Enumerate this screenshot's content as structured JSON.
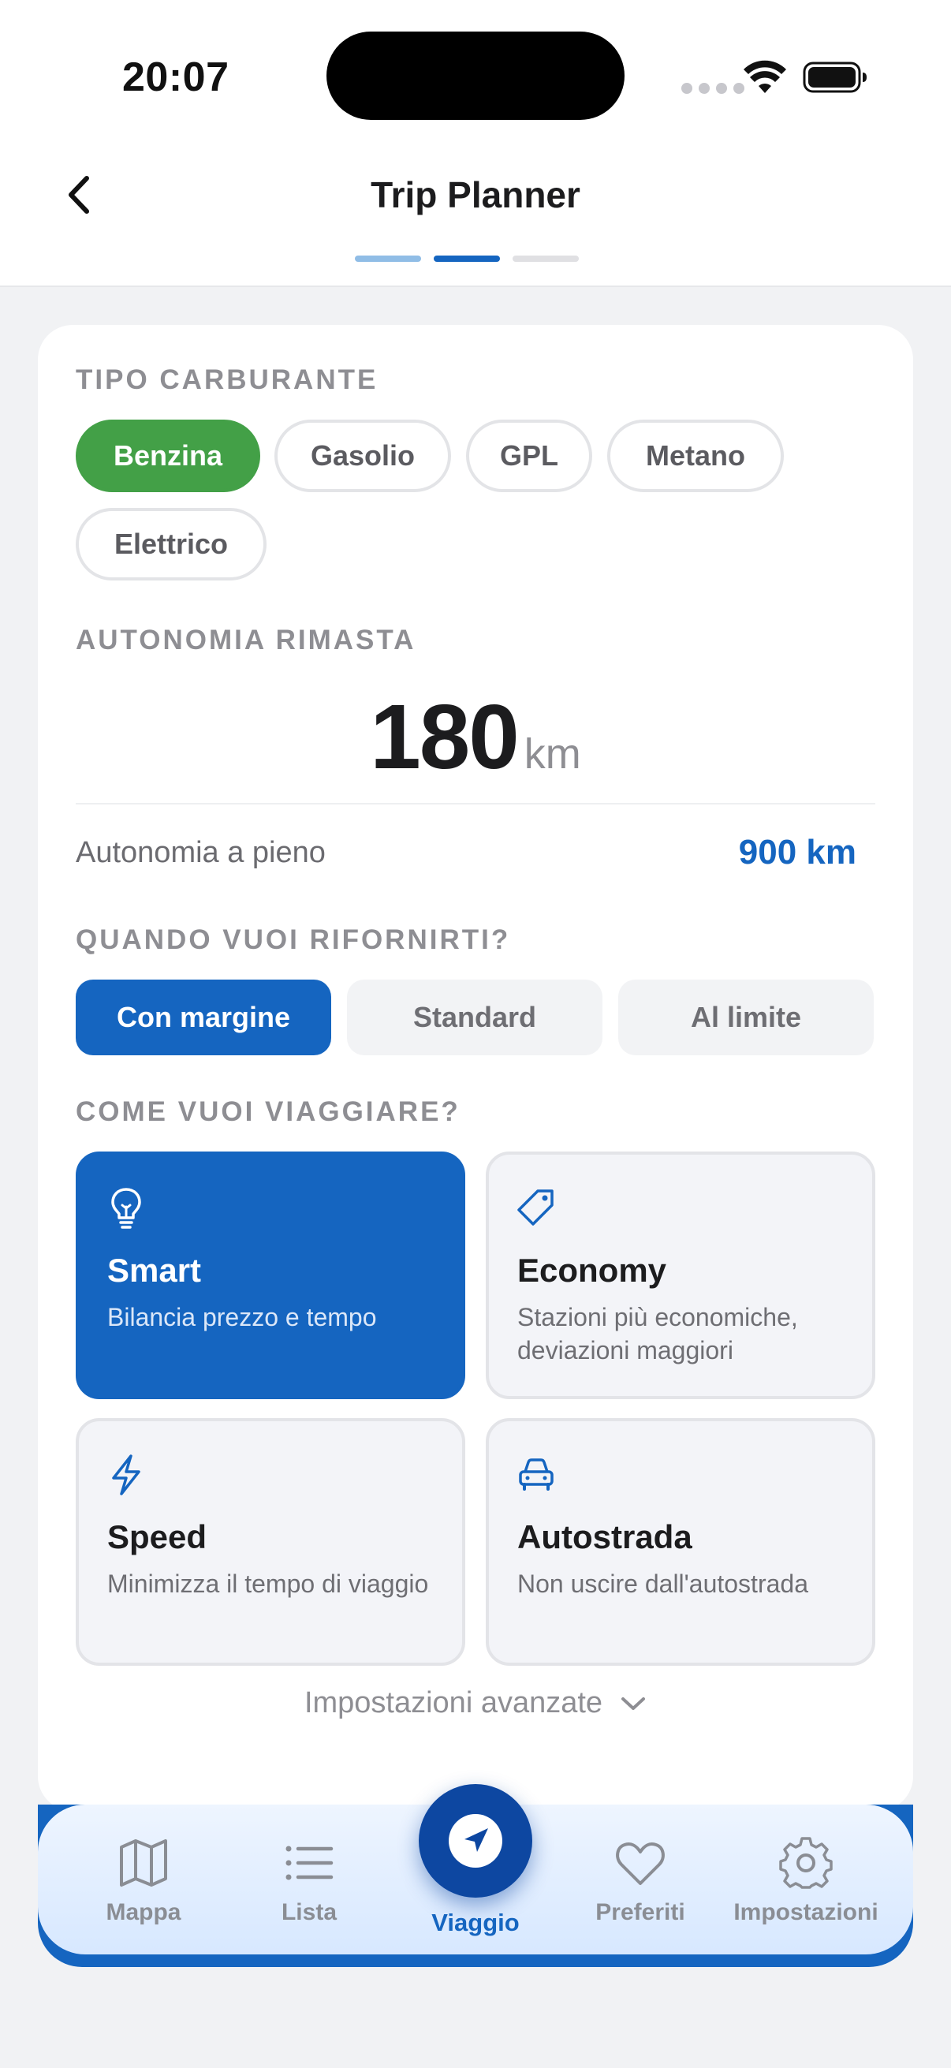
{
  "status": {
    "time": "20:07"
  },
  "header": {
    "title": "Trip Planner"
  },
  "fuel": {
    "label": "TIPO CARBURANTE",
    "options": [
      "Benzina",
      "Gasolio",
      "GPL",
      "Metano",
      "Elettrico"
    ],
    "selected": "Benzina"
  },
  "range": {
    "label": "AUTONOMIA RIMASTA",
    "value": "180",
    "unit": "km",
    "full_label": "Autonomia a pieno",
    "full_value": "900 km"
  },
  "refuel": {
    "label": "QUANDO VUOI RIFORNIRTI?",
    "options": [
      "Con margine",
      "Standard",
      "Al limite"
    ],
    "selected": "Con margine"
  },
  "travel": {
    "label": "COME VUOI VIAGGIARE?",
    "modes": [
      {
        "title": "Smart",
        "desc": "Bilancia prezzo e tempo",
        "icon": "lightbulb-icon"
      },
      {
        "title": "Economy",
        "desc": "Stazioni più economiche, deviazioni maggiori",
        "icon": "tag-icon"
      },
      {
        "title": "Speed",
        "desc": "Minimizza il tempo di viaggio",
        "icon": "lightning-icon"
      },
      {
        "title": "Autostrada",
        "desc": "Non uscire dall'autostrada",
        "icon": "car-icon"
      }
    ],
    "selected": "Smart"
  },
  "advanced": {
    "label": "Impostazioni avanzate"
  },
  "tabbar": {
    "items": [
      {
        "label": "Mappa",
        "icon": "map-icon"
      },
      {
        "label": "Lista",
        "icon": "list-icon"
      },
      {
        "label": "Viaggio",
        "icon": "navigation-arrow-icon"
      },
      {
        "label": "Preferiti",
        "icon": "heart-icon"
      },
      {
        "label": "Impostazioni",
        "icon": "gear-icon"
      }
    ],
    "active": "Viaggio"
  },
  "colors": {
    "primary": "#1565c0",
    "fuel_active": "#43a047",
    "label_gray": "#8e8e93",
    "tab_center": "#0d47a1"
  }
}
